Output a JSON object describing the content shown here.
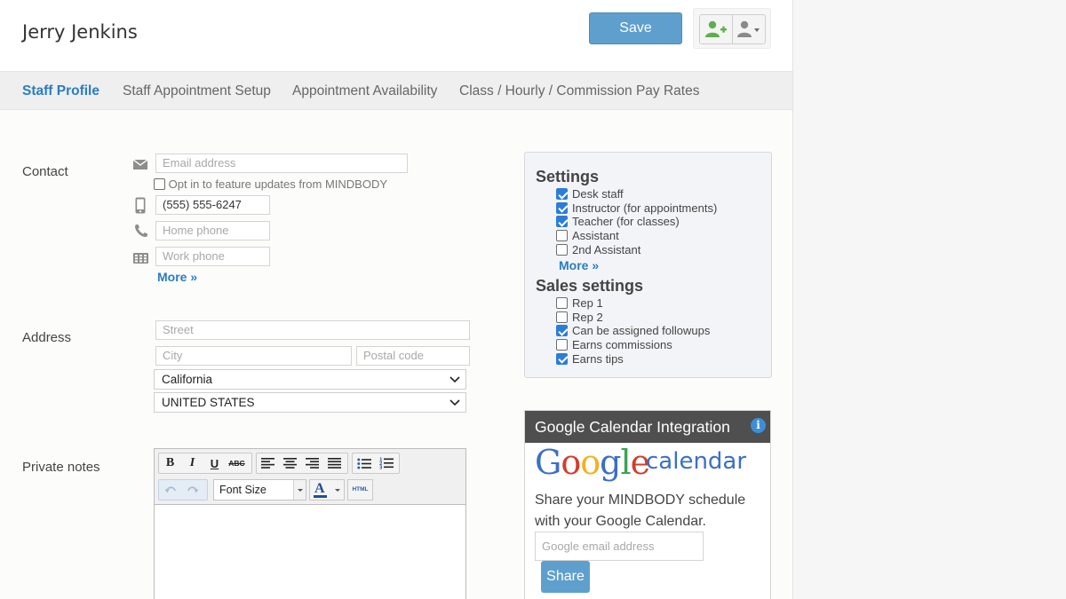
{
  "header": {
    "title": "Jerry Jenkins",
    "save_label": "Save"
  },
  "tabs": [
    {
      "label": "Staff Profile",
      "active": true
    },
    {
      "label": "Staff Appointment Setup"
    },
    {
      "label": "Appointment Availability"
    },
    {
      "label": "Class / Hourly / Commission Pay Rates"
    }
  ],
  "contact": {
    "label": "Contact",
    "email_placeholder": "Email address",
    "opt_in_label": "Opt in to feature updates from MINDBODY",
    "opt_in_checked": false,
    "mobile_value": "(555) 555-6247",
    "home_placeholder": "Home phone",
    "work_placeholder": "Work phone",
    "more_label": "More »"
  },
  "address": {
    "label": "Address",
    "street_placeholder": "Street",
    "city_placeholder": "City",
    "postal_placeholder": "Postal code",
    "state_value": "California",
    "country_value": "UNITED STATES"
  },
  "notes": {
    "label": "Private notes",
    "toolbar": {
      "bold": "B",
      "italic": "I",
      "underline": "U",
      "strike": "ABC",
      "font_size_label": "Font Size",
      "font_color": "A",
      "html": "HTML"
    }
  },
  "settings": {
    "title": "Settings",
    "items": [
      {
        "label": "Desk staff",
        "checked": true
      },
      {
        "label": "Instructor (for appointments)",
        "checked": true
      },
      {
        "label": "Teacher (for classes)",
        "checked": true
      },
      {
        "label": "Assistant",
        "checked": false
      },
      {
        "label": "2nd Assistant",
        "checked": false
      }
    ],
    "more_label": "More »",
    "sales_title": "Sales settings",
    "sales_items": [
      {
        "label": "Rep 1",
        "checked": false
      },
      {
        "label": "Rep 2",
        "checked": false
      },
      {
        "label": "Can be assigned followups",
        "checked": true
      },
      {
        "label": "Earns commissions",
        "checked": false
      },
      {
        "label": "Earns tips",
        "checked": true
      }
    ]
  },
  "google": {
    "title": "Google Calendar Integration",
    "logo_text": "Google",
    "calendar_text": "calendar",
    "description": "Share your MINDBODY schedule with your Google Calendar.",
    "email_placeholder": "Google email address",
    "share_label": "Share"
  },
  "colors": {
    "accent": "#2a7dc2",
    "button": "#5f9fcd",
    "checkbox": "#2b7dd8"
  }
}
